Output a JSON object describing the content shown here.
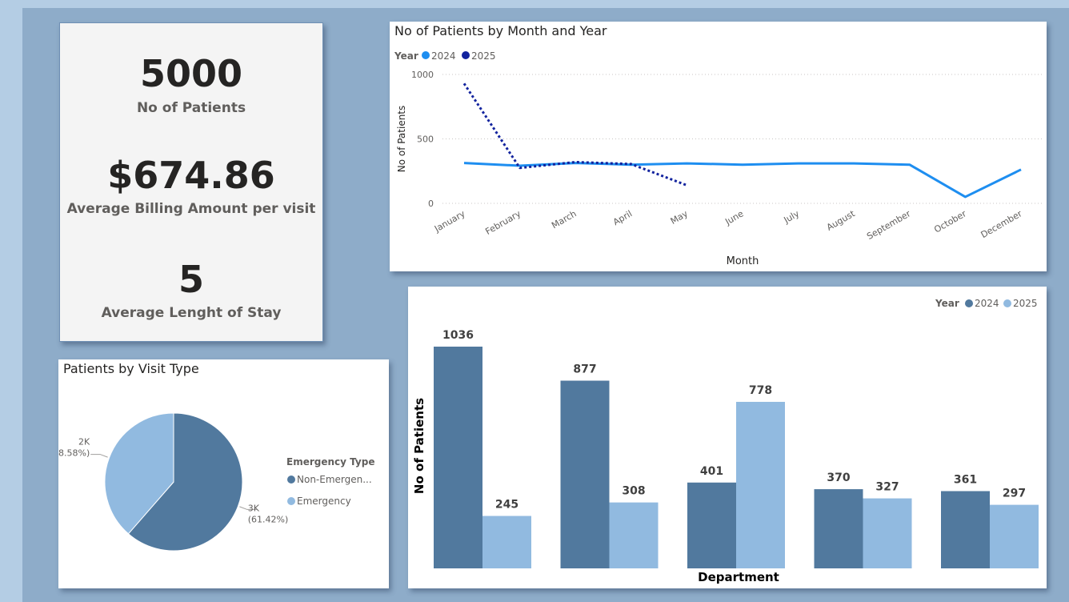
{
  "kpis": {
    "patients_value": "5000",
    "patients_label": "No of Patients",
    "billing_value": "$674.86",
    "billing_label": "Average Billing Amount per visit",
    "stay_value": "5",
    "stay_label": "Average Lenght of Stay"
  },
  "colors": {
    "line_2024": "#1e8ef0",
    "line_2025": "#12239e",
    "bar_2024": "#51799e",
    "bar_2025": "#91bae0",
    "pie_non_emergency": "#51799e",
    "pie_emergency": "#91bae0"
  },
  "chart_data": [
    {
      "type": "line",
      "title": "No of Patients by Month and Year",
      "xlabel": "Month",
      "ylabel": "No of Patients",
      "legend_title": "Year",
      "legend_position": "top-left",
      "ylim": [
        0,
        1000
      ],
      "yticks": [
        "0",
        "500",
        "1000"
      ],
      "grid": true,
      "categories": [
        "January",
        "February",
        "March",
        "April",
        "May",
        "June",
        "July",
        "August",
        "September",
        "October",
        "December"
      ],
      "series": [
        {
          "name": "2024",
          "style": "solid",
          "values": [
            313,
            292,
            313,
            300,
            310,
            300,
            310,
            310,
            300,
            50,
            262
          ]
        },
        {
          "name": "2025",
          "style": "dotted",
          "values": [
            930,
            275,
            320,
            305,
            140,
            null,
            null,
            null,
            null,
            null,
            null
          ]
        }
      ]
    },
    {
      "type": "pie",
      "title": "Patients by Visit Type",
      "legend_title": "Emergency Type",
      "legend_position": "right",
      "slices": [
        {
          "name": "Non-Emergen...",
          "value": 61.42,
          "label": "3K",
          "pct_label": "(61.42%)"
        },
        {
          "name": "Emergency",
          "value": 38.58,
          "label": "2K",
          "pct_label": "(38.58%)"
        }
      ]
    },
    {
      "type": "bar",
      "title": "",
      "xlabel": "Department",
      "ylabel": "No of Patients",
      "legend_title": "Year",
      "legend_position": "top-right",
      "categories": [
        "",
        "",
        "",
        "",
        ""
      ],
      "ylim": [
        0,
        1036
      ],
      "series": [
        {
          "name": "2024",
          "values": [
            1036,
            877,
            401,
            370,
            361
          ]
        },
        {
          "name": "2025",
          "values": [
            245,
            308,
            778,
            327,
            297
          ]
        }
      ]
    }
  ]
}
